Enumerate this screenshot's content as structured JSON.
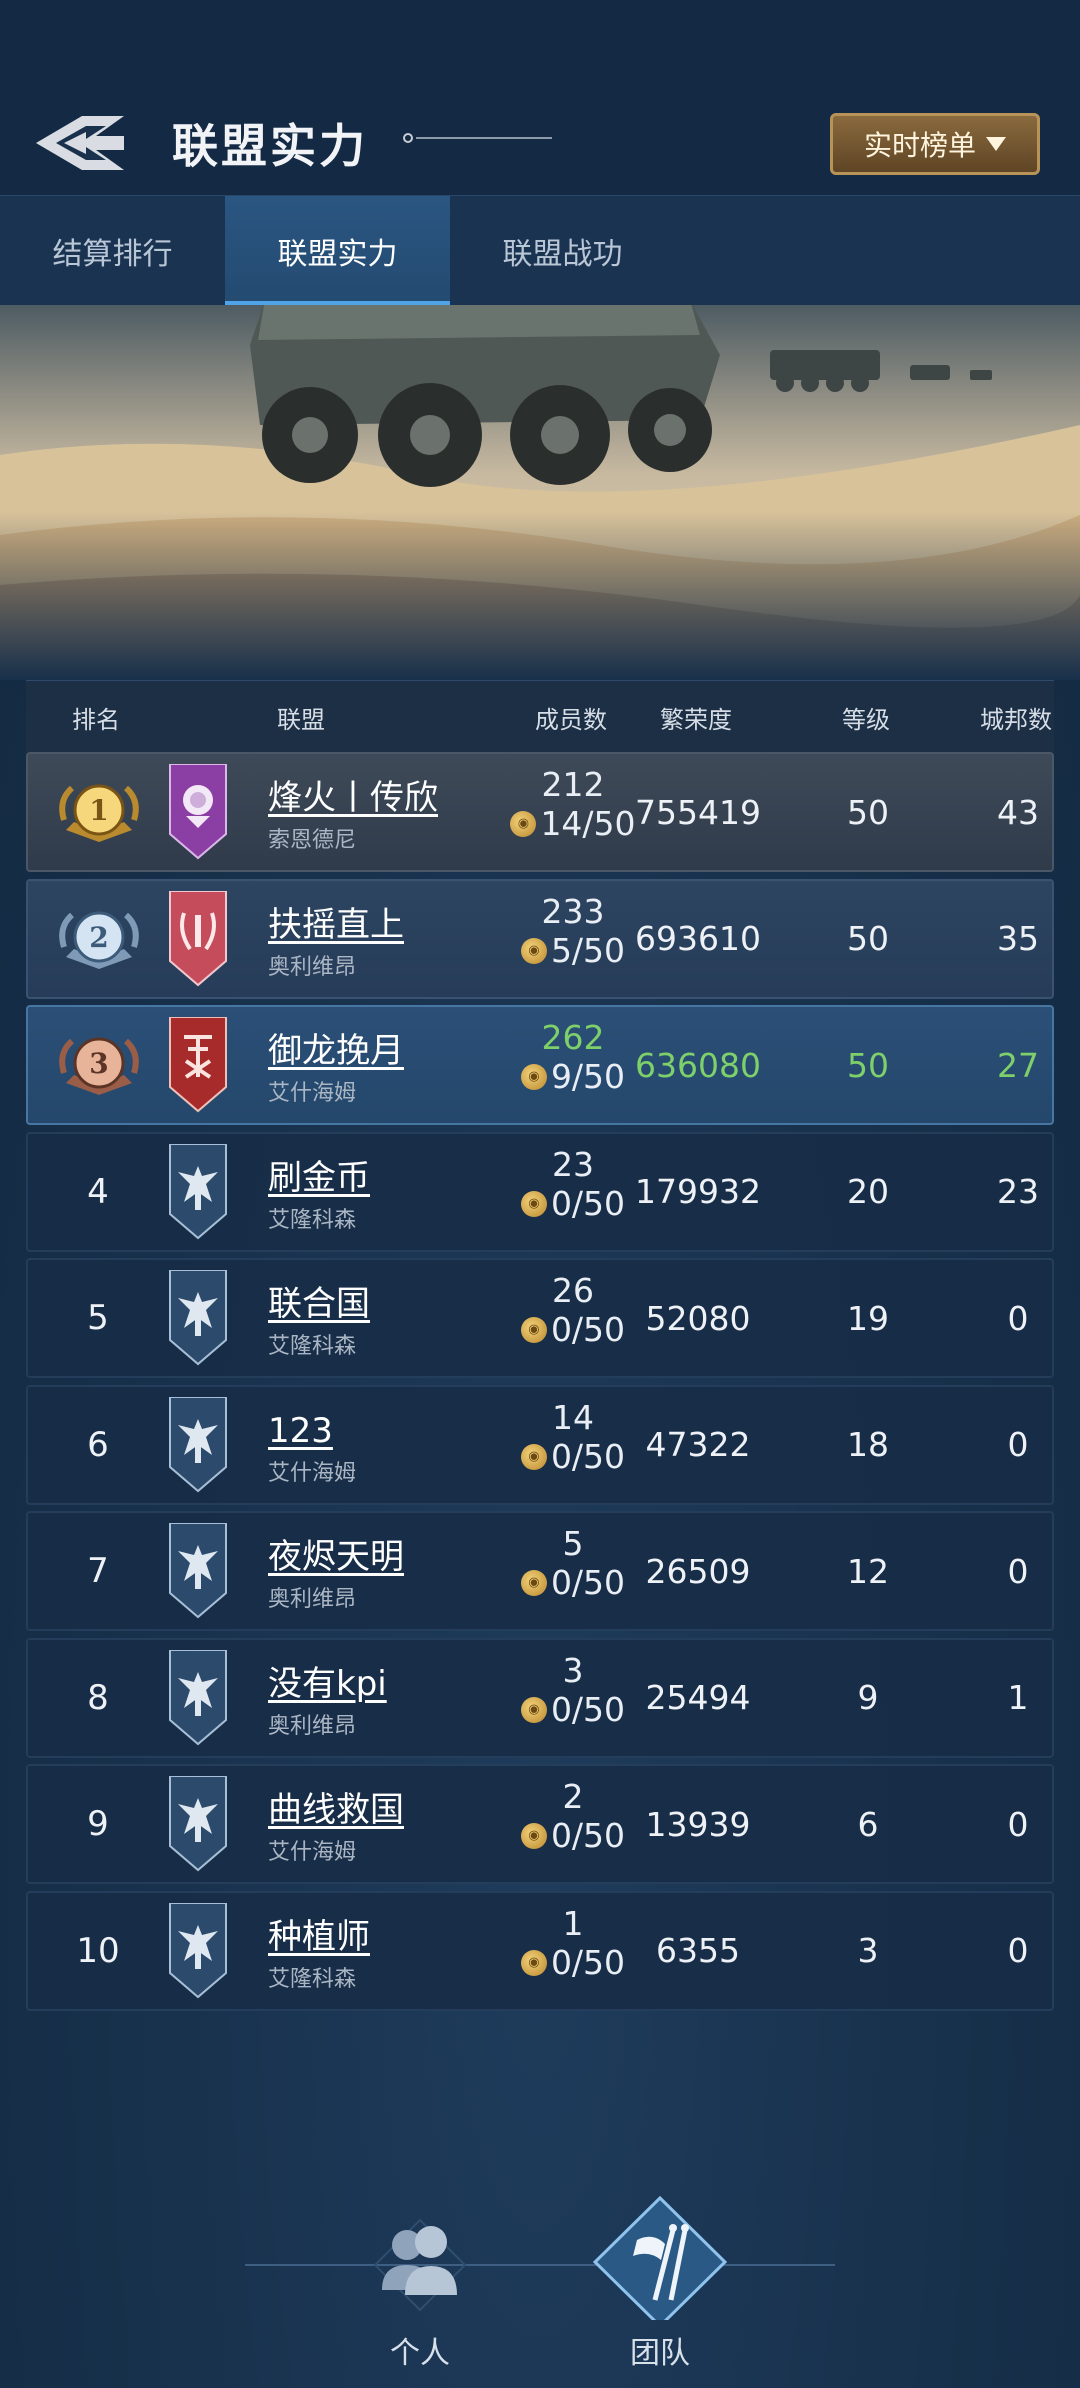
{
  "header": {
    "title": "联盟实力",
    "realtime_button": "实时榜单"
  },
  "tabs": [
    {
      "label": "结算排行",
      "active": false
    },
    {
      "label": "联盟实力",
      "active": true
    },
    {
      "label": "联盟战功",
      "active": false
    }
  ],
  "table": {
    "columns": [
      "排名",
      "联盟",
      "成员数",
      "繁荣度",
      "等级",
      "城邦数"
    ],
    "rows": [
      {
        "rank": "1",
        "name": "烽火丨传欣",
        "server": "索恩德尼",
        "members": "212",
        "capacity": "14/50",
        "prosperity": "755419",
        "level": "50",
        "cities": "43",
        "medal": "gold",
        "emblem": "rose"
      },
      {
        "rank": "2",
        "name": "扶摇直上",
        "server": "奥利维昂",
        "members": "233",
        "capacity": "5/50",
        "prosperity": "693610",
        "level": "50",
        "cities": "35",
        "medal": "silver",
        "emblem": "wreath"
      },
      {
        "rank": "3",
        "name": "御龙挽月",
        "server": "艾什海姆",
        "members": "262",
        "capacity": "9/50",
        "prosperity": "636080",
        "level": "50",
        "cities": "27",
        "medal": "bronze",
        "emblem": "rune",
        "highlighted": true
      },
      {
        "rank": "4",
        "name": "刷金币",
        "server": "艾隆科森",
        "members": "23",
        "capacity": "0/50",
        "prosperity": "179932",
        "level": "20",
        "cities": "23",
        "emblem": "eagle"
      },
      {
        "rank": "5",
        "name": "联合国",
        "server": "艾隆科森",
        "members": "26",
        "capacity": "0/50",
        "prosperity": "52080",
        "level": "19",
        "cities": "0",
        "emblem": "eagle"
      },
      {
        "rank": "6",
        "name": "123",
        "server": "艾什海姆",
        "members": "14",
        "capacity": "0/50",
        "prosperity": "47322",
        "level": "18",
        "cities": "0",
        "emblem": "eagle"
      },
      {
        "rank": "7",
        "name": "夜烬天明",
        "server": "奥利维昂",
        "members": "5",
        "capacity": "0/50",
        "prosperity": "26509",
        "level": "12",
        "cities": "0",
        "emblem": "eagle"
      },
      {
        "rank": "8",
        "name": "没有kpi",
        "server": "奥利维昂",
        "members": "3",
        "capacity": "0/50",
        "prosperity": "25494",
        "level": "9",
        "cities": "1",
        "emblem": "eagle"
      },
      {
        "rank": "9",
        "name": "曲线救国",
        "server": "艾什海姆",
        "members": "2",
        "capacity": "0/50",
        "prosperity": "13939",
        "level": "6",
        "cities": "0",
        "emblem": "eagle"
      },
      {
        "rank": "10",
        "name": "种植师",
        "server": "艾隆科森",
        "members": "1",
        "capacity": "0/50",
        "prosperity": "6355",
        "level": "3",
        "cities": "0",
        "emblem": "eagle"
      }
    ]
  },
  "bottom_nav": [
    {
      "label": "个人",
      "icon": "person-group-icon",
      "active": false
    },
    {
      "label": "团队",
      "icon": "team-flag-icon",
      "active": true
    }
  ],
  "colors": {
    "highlight_text": "#7ed06a",
    "accent_tab": "#4fa3e6",
    "gold_button": "#8a6a3e"
  }
}
